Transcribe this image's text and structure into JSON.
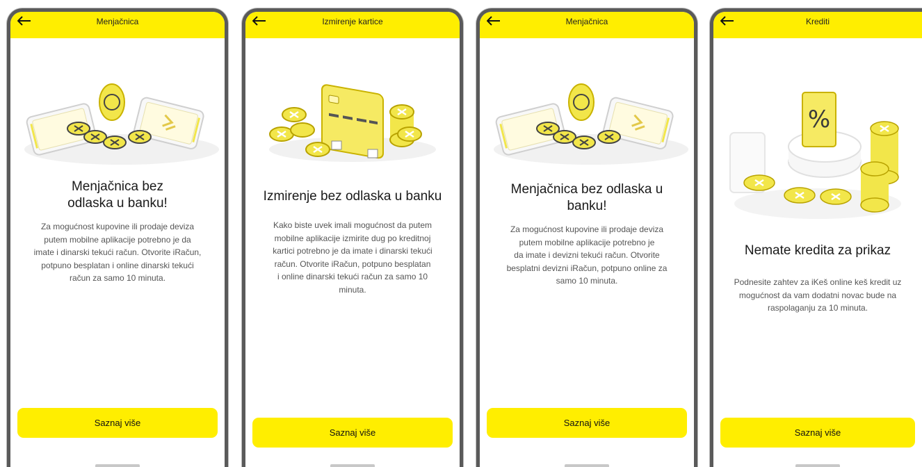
{
  "colors": {
    "accent": "#ffee00",
    "frame": "#5a5a5a",
    "coin": "#f2e64a",
    "text": "#1a1a1a",
    "muted": "#555555"
  },
  "screens": [
    {
      "header_title": "Menjačnica",
      "icon": "arrow-left-icon",
      "illustration": "currency-exchange-phones-illustration",
      "headline_line1": "Menjačnica bez",
      "headline_line2": "odlaska u banku!",
      "body_lines": [
        "Za mogućnost kupovine ili prodaje deviza",
        "putem mobilne aplikacije potrebno je da",
        "imate i dinarski tekući račun. Otvorite iRačun,",
        "potpuno besplatan i online dinarski tekući",
        "račun za samo 10 minuta."
      ],
      "button_label": "Saznaj više"
    },
    {
      "header_title": "Izmirenje kartice",
      "icon": "arrow-left-icon",
      "illustration": "credit-card-coins-illustration",
      "headline_line1": "Izmirenje bez odlaska u banku",
      "body_lines": [
        "Kako biste uvek imali mogućnost da putem",
        "mobilne aplikacije izmirite dug po kreditnoj",
        "kartici potrebno je da imate i dinarski tekući",
        "račun. Otvorite iRačun, potpuno besplatan",
        "i online dinarski tekući račun za samo 10",
        "minuta."
      ],
      "button_label": "Saznaj više"
    },
    {
      "header_title": "Menjačnica",
      "icon": "arrow-left-icon",
      "illustration": "currency-exchange-phones-illustration",
      "headline_line1": "Menjačnica bez odlaska u",
      "headline_line2": "banku!",
      "body_lines": [
        "Za mogućnost kupovine ili prodaje deviza",
        "putem mobilne aplikacije potrebno je",
        "da imate i devizni tekući račun. Otvorite",
        "besplatni devizni iRačun, potpuno online za",
        "samo 10 minuta."
      ],
      "button_label": "Saznaj više"
    },
    {
      "header_title": "Krediti",
      "icon": "arrow-left-icon",
      "illustration": "percent-loan-coins-illustration",
      "headline_line1": "Nemate kredita za prikaz",
      "body_lines": [
        "Podnesite zahtev za iKeš online keš kredit uz",
        "mogućnost da vam dodatni novac bude na",
        "raspolaganju za 10 minuta."
      ],
      "button_label": "Saznaj više"
    }
  ]
}
